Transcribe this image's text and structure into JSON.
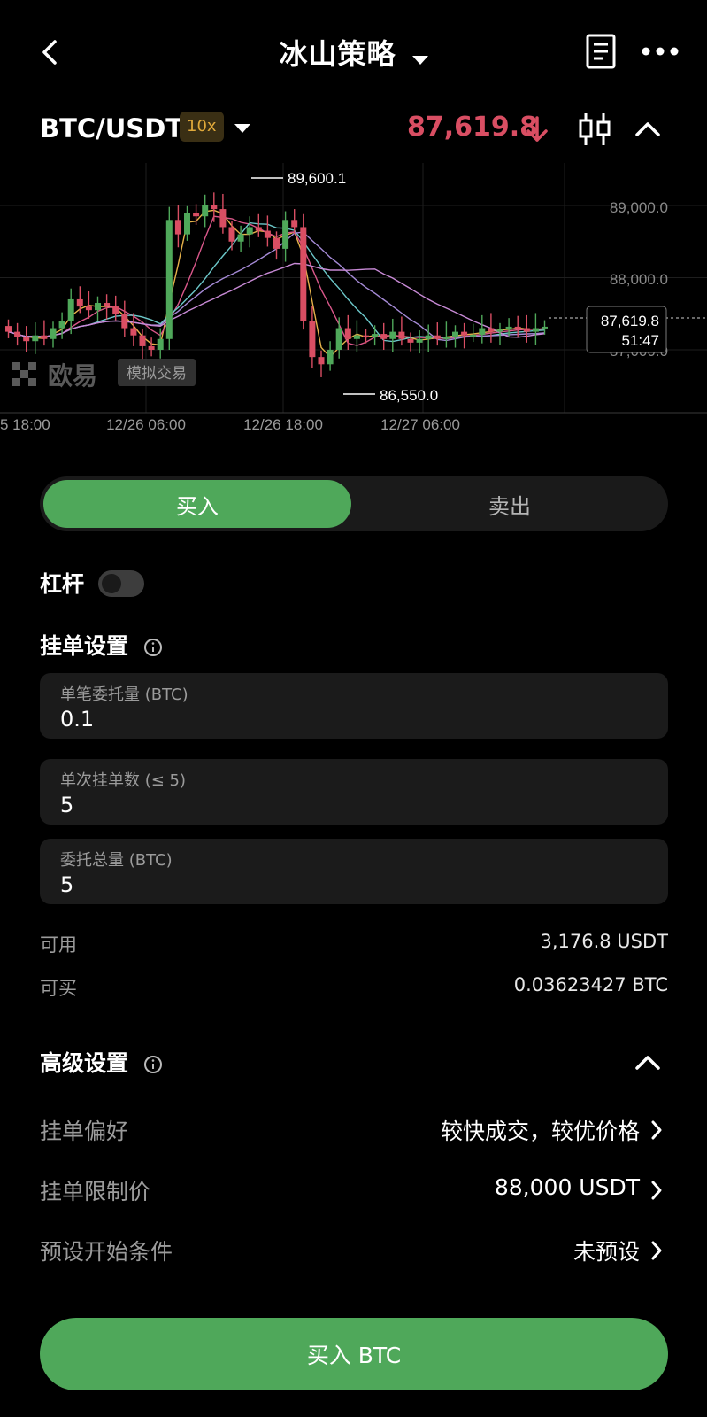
{
  "header": {
    "title": "冰山策略"
  },
  "pair": {
    "symbol": "BTC/USDT",
    "leverage_badge": "10x",
    "price": "87,619.8"
  },
  "chart": {
    "y_ticks": [
      "89,000.0",
      "88,000.0",
      "87,000.0"
    ],
    "x_ticks": [
      "5 18:00",
      "12/26 06:00",
      "12/26 18:00",
      "12/27 06:00"
    ],
    "high_label": "89,600.1",
    "low_label": "86,550.0",
    "current_price": "87,619.8",
    "countdown": "51:47",
    "watermark": "欧易",
    "demo_badge": "模拟交易"
  },
  "chart_data": {
    "type": "candlestick",
    "x": [
      "5 18:00",
      "12/26 06:00",
      "12/26 18:00",
      "12/27 06:00"
    ],
    "high": 89600.1,
    "low": 86550.0,
    "last": 87619.8,
    "ylim": [
      86700,
      89300
    ]
  },
  "tabs": {
    "buy": "买入",
    "sell": "卖出"
  },
  "leverage": {
    "label": "杠杆"
  },
  "order_settings": {
    "title": "挂单设置",
    "fields": [
      {
        "label": "单笔委托量 (BTC)",
        "value": "0.1"
      },
      {
        "label": "单次挂单数 (≤ 5)",
        "value": "5"
      },
      {
        "label": "委托总量 (BTC)",
        "value": "5"
      }
    ]
  },
  "balances": {
    "available_label": "可用",
    "available_value": "3,176.8 USDT",
    "buyable_label": "可买",
    "buyable_value": "0.03623427 BTC"
  },
  "advanced": {
    "title": "高级设置",
    "rows": [
      {
        "label": "挂单偏好",
        "value": "较快成交，较优价格"
      },
      {
        "label": "挂单限制价",
        "value": "88,000 USDT"
      },
      {
        "label": "预设开始条件",
        "value": "未预设"
      }
    ]
  },
  "submit": {
    "label": "买入 BTC"
  },
  "colors": {
    "up": "#4fa85a",
    "down": "#d94e63",
    "badge": "#e0a93a"
  }
}
